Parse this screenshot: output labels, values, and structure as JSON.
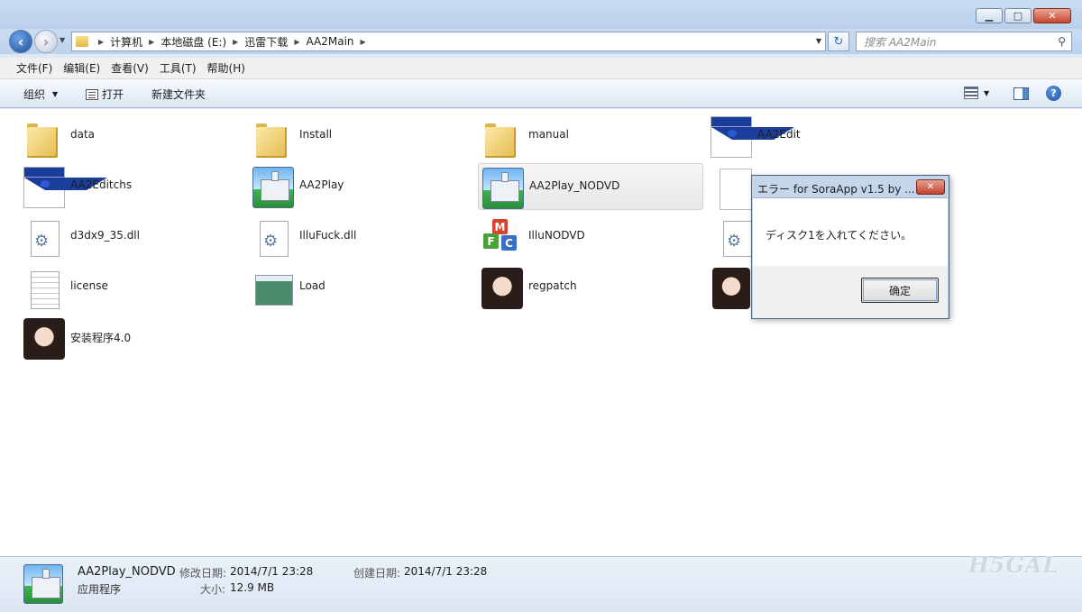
{
  "window": {
    "minimize": "▁",
    "maximize": "□",
    "close": "✕"
  },
  "nav": {
    "back": "‹",
    "forward": "›",
    "breadcrumb": [
      "计算机",
      "本地磁盘 (E:)",
      "迅雷下载",
      "AA2Main"
    ],
    "search_placeholder": "搜索 AA2Main"
  },
  "menu": [
    "文件(F)",
    "编辑(E)",
    "查看(V)",
    "工具(T)",
    "帮助(H)"
  ],
  "toolbar": {
    "organize": "组织",
    "open": "打开",
    "new_folder": "新建文件夹"
  },
  "files": [
    {
      "name": "data",
      "icon": "folder-icon"
    },
    {
      "name": "Install",
      "icon": "folder-icon"
    },
    {
      "name": "manual",
      "icon": "folder-icon"
    },
    {
      "name": "AA2Edit",
      "icon": "app-icon"
    },
    {
      "name": "AA2Editchs",
      "icon": "app-icon"
    },
    {
      "name": "AA2Play",
      "icon": "game-icon"
    },
    {
      "name": "AA2Play_NODVD",
      "icon": "game-icon",
      "selected": true
    },
    {
      "name": "d3dx9_35.dll",
      "icon": "dll-icon"
    },
    {
      "name": "IlluFuck.dll",
      "icon": "dll-icon"
    },
    {
      "name": "IlluNODVD",
      "icon": "mfc-icon"
    },
    {
      "name": "license",
      "icon": "text-file-icon"
    },
    {
      "name": "Load",
      "icon": "exe-icon"
    },
    {
      "name": "regpatch",
      "icon": "portrait-icon"
    },
    {
      "name": "安装程序4.0",
      "icon": "portrait-icon"
    }
  ],
  "dialog": {
    "title": "エラー  for SoraApp v1.5 by ...",
    "message": "ディスク1を入れてください。",
    "ok": "确定"
  },
  "details": {
    "name": "AA2Play_NODVD",
    "type": "应用程序",
    "modified_label": "修改日期:",
    "modified_value": "2014/7/1 23:28",
    "created_label": "创建日期:",
    "created_value": "2014/7/1 23:28",
    "size_label": "大小:",
    "size_value": "12.9 MB"
  },
  "watermark": "H5GAL"
}
